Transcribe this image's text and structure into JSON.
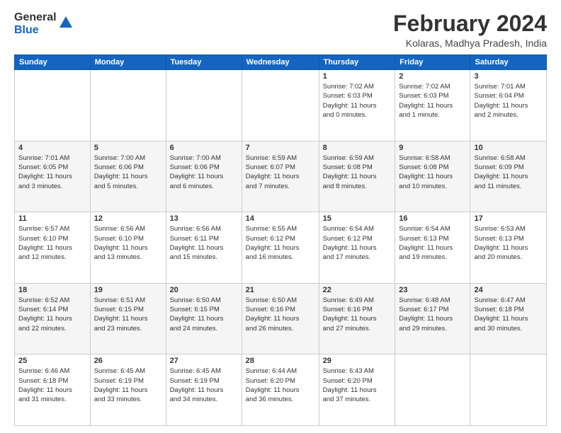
{
  "header": {
    "logo_line1": "General",
    "logo_line2": "Blue",
    "title": "February 2024",
    "subtitle": "Kolaras, Madhya Pradesh, India"
  },
  "calendar": {
    "weekdays": [
      "Sunday",
      "Monday",
      "Tuesday",
      "Wednesday",
      "Thursday",
      "Friday",
      "Saturday"
    ],
    "weeks": [
      [
        {
          "day": "",
          "info": ""
        },
        {
          "day": "",
          "info": ""
        },
        {
          "day": "",
          "info": ""
        },
        {
          "day": "",
          "info": ""
        },
        {
          "day": "1",
          "info": "Sunrise: 7:02 AM\nSunset: 6:03 PM\nDaylight: 11 hours\nand 0 minutes."
        },
        {
          "day": "2",
          "info": "Sunrise: 7:02 AM\nSunset: 6:03 PM\nDaylight: 11 hours\nand 1 minute."
        },
        {
          "day": "3",
          "info": "Sunrise: 7:01 AM\nSunset: 6:04 PM\nDaylight: 11 hours\nand 2 minutes."
        }
      ],
      [
        {
          "day": "4",
          "info": "Sunrise: 7:01 AM\nSunset: 6:05 PM\nDaylight: 11 hours\nand 3 minutes."
        },
        {
          "day": "5",
          "info": "Sunrise: 7:00 AM\nSunset: 6:06 PM\nDaylight: 11 hours\nand 5 minutes."
        },
        {
          "day": "6",
          "info": "Sunrise: 7:00 AM\nSunset: 6:06 PM\nDaylight: 11 hours\nand 6 minutes."
        },
        {
          "day": "7",
          "info": "Sunrise: 6:59 AM\nSunset: 6:07 PM\nDaylight: 11 hours\nand 7 minutes."
        },
        {
          "day": "8",
          "info": "Sunrise: 6:59 AM\nSunset: 6:08 PM\nDaylight: 11 hours\nand 8 minutes."
        },
        {
          "day": "9",
          "info": "Sunrise: 6:58 AM\nSunset: 6:08 PM\nDaylight: 11 hours\nand 10 minutes."
        },
        {
          "day": "10",
          "info": "Sunrise: 6:58 AM\nSunset: 6:09 PM\nDaylight: 11 hours\nand 11 minutes."
        }
      ],
      [
        {
          "day": "11",
          "info": "Sunrise: 6:57 AM\nSunset: 6:10 PM\nDaylight: 11 hours\nand 12 minutes."
        },
        {
          "day": "12",
          "info": "Sunrise: 6:56 AM\nSunset: 6:10 PM\nDaylight: 11 hours\nand 13 minutes."
        },
        {
          "day": "13",
          "info": "Sunrise: 6:56 AM\nSunset: 6:11 PM\nDaylight: 11 hours\nand 15 minutes."
        },
        {
          "day": "14",
          "info": "Sunrise: 6:55 AM\nSunset: 6:12 PM\nDaylight: 11 hours\nand 16 minutes."
        },
        {
          "day": "15",
          "info": "Sunrise: 6:54 AM\nSunset: 6:12 PM\nDaylight: 11 hours\nand 17 minutes."
        },
        {
          "day": "16",
          "info": "Sunrise: 6:54 AM\nSunset: 6:13 PM\nDaylight: 11 hours\nand 19 minutes."
        },
        {
          "day": "17",
          "info": "Sunrise: 6:53 AM\nSunset: 6:13 PM\nDaylight: 11 hours\nand 20 minutes."
        }
      ],
      [
        {
          "day": "18",
          "info": "Sunrise: 6:52 AM\nSunset: 6:14 PM\nDaylight: 11 hours\nand 22 minutes."
        },
        {
          "day": "19",
          "info": "Sunrise: 6:51 AM\nSunset: 6:15 PM\nDaylight: 11 hours\nand 23 minutes."
        },
        {
          "day": "20",
          "info": "Sunrise: 6:50 AM\nSunset: 6:15 PM\nDaylight: 11 hours\nand 24 minutes."
        },
        {
          "day": "21",
          "info": "Sunrise: 6:50 AM\nSunset: 6:16 PM\nDaylight: 11 hours\nand 26 minutes."
        },
        {
          "day": "22",
          "info": "Sunrise: 6:49 AM\nSunset: 6:16 PM\nDaylight: 11 hours\nand 27 minutes."
        },
        {
          "day": "23",
          "info": "Sunrise: 6:48 AM\nSunset: 6:17 PM\nDaylight: 11 hours\nand 29 minutes."
        },
        {
          "day": "24",
          "info": "Sunrise: 6:47 AM\nSunset: 6:18 PM\nDaylight: 11 hours\nand 30 minutes."
        }
      ],
      [
        {
          "day": "25",
          "info": "Sunrise: 6:46 AM\nSunset: 6:18 PM\nDaylight: 11 hours\nand 31 minutes."
        },
        {
          "day": "26",
          "info": "Sunrise: 6:45 AM\nSunset: 6:19 PM\nDaylight: 11 hours\nand 33 minutes."
        },
        {
          "day": "27",
          "info": "Sunrise: 6:45 AM\nSunset: 6:19 PM\nDaylight: 11 hours\nand 34 minutes."
        },
        {
          "day": "28",
          "info": "Sunrise: 6:44 AM\nSunset: 6:20 PM\nDaylight: 11 hours\nand 36 minutes."
        },
        {
          "day": "29",
          "info": "Sunrise: 6:43 AM\nSunset: 6:20 PM\nDaylight: 11 hours\nand 37 minutes."
        },
        {
          "day": "",
          "info": ""
        },
        {
          "day": "",
          "info": ""
        }
      ]
    ]
  }
}
